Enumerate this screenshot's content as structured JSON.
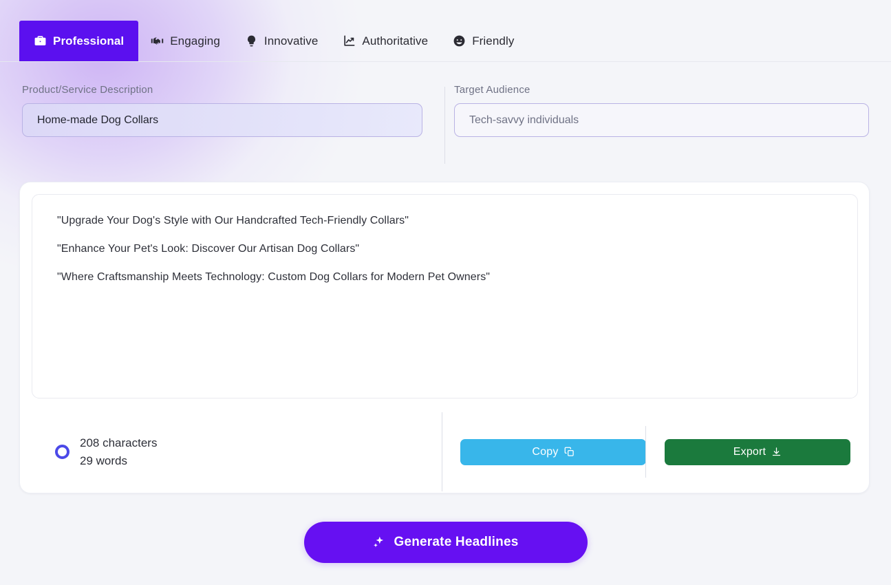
{
  "theme": {
    "accent_purple": "#5b10ef",
    "generate_purple": "#6610f2",
    "copy_blue": "#38b6ea",
    "export_green": "#1b7a3d",
    "ring_blue": "#4b49e8",
    "page_background": "#f4f5f9"
  },
  "tabs": [
    {
      "label": "Professional",
      "icon": "briefcase-icon",
      "active": true
    },
    {
      "label": "Engaging",
      "icon": "handshake-icon",
      "active": false
    },
    {
      "label": "Innovative",
      "icon": "lightbulb-icon",
      "active": false
    },
    {
      "label": "Authoritative",
      "icon": "chart-line-icon",
      "active": false
    },
    {
      "label": "Friendly",
      "icon": "smiley-icon",
      "active": false
    }
  ],
  "fields": {
    "product": {
      "label": "Product/Service Description",
      "value": "Home-made Dog Collars",
      "placeholder": "Home-made Dog Collars"
    },
    "audience": {
      "label": "Target Audience",
      "value": "",
      "placeholder": "Tech-savvy individuals"
    }
  },
  "result": {
    "lines": [
      "\"Upgrade Your Dog's Style with Our Handcrafted Tech-Friendly Collars\"",
      "\"Enhance Your Pet's Look: Discover Our Artisan Dog Collars\"",
      "\"Where Craftsmanship Meets Technology: Custom Dog Collars for Modern Pet Owners\""
    ]
  },
  "stats": {
    "characters": "208 characters",
    "words": "29 words"
  },
  "actions": {
    "copy_label": "Copy",
    "copy_icon": "copy-icon",
    "export_label": "Export",
    "export_icon": "download-icon"
  },
  "generate": {
    "label": "Generate Headlines",
    "icon": "sparkles-icon"
  }
}
